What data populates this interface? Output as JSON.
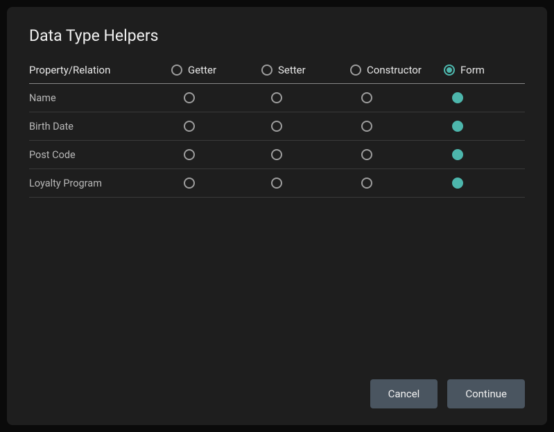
{
  "title": "Data Type Helpers",
  "columns": {
    "property": "Property/Relation",
    "getter": "Getter",
    "setter": "Setter",
    "constructor": "Constructor",
    "form": "Form"
  },
  "header_selected": "form",
  "rows": [
    {
      "name": "Name",
      "selected": "form"
    },
    {
      "name": "Birth Date",
      "selected": "form"
    },
    {
      "name": "Post Code",
      "selected": "form"
    },
    {
      "name": "Loyalty Program",
      "selected": "form"
    }
  ],
  "buttons": {
    "cancel": "Cancel",
    "continue": "Continue"
  },
  "colors": {
    "accent": "#4db6ac",
    "bg": "#1e1e1e",
    "text": "#e8e8e8",
    "muted": "#b8b8b8"
  }
}
